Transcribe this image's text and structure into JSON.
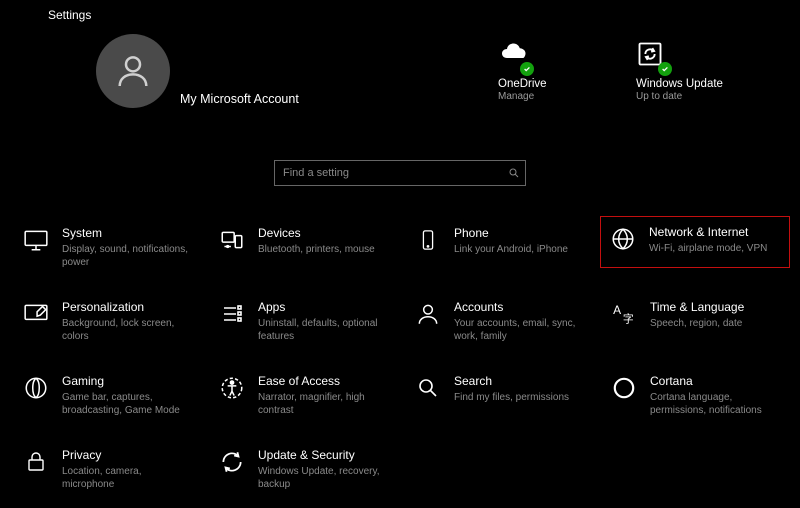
{
  "window_title": "Settings",
  "account": {
    "name": "My Microsoft Account"
  },
  "status_tiles": {
    "onedrive": {
      "title": "OneDrive",
      "subtitle": "Manage"
    },
    "update": {
      "title": "Windows Update",
      "subtitle": "Up to date"
    }
  },
  "search": {
    "placeholder": "Find a setting"
  },
  "categories": {
    "system": {
      "title": "System",
      "subtitle": "Display, sound, notifications, power"
    },
    "devices": {
      "title": "Devices",
      "subtitle": "Bluetooth, printers, mouse"
    },
    "phone": {
      "title": "Phone",
      "subtitle": "Link your Android, iPhone"
    },
    "network": {
      "title": "Network & Internet",
      "subtitle": "Wi-Fi, airplane mode, VPN"
    },
    "personalization": {
      "title": "Personalization",
      "subtitle": "Background, lock screen, colors"
    },
    "apps": {
      "title": "Apps",
      "subtitle": "Uninstall, defaults, optional features"
    },
    "accounts": {
      "title": "Accounts",
      "subtitle": "Your accounts, email, sync, work, family"
    },
    "time": {
      "title": "Time & Language",
      "subtitle": "Speech, region, date"
    },
    "gaming": {
      "title": "Gaming",
      "subtitle": "Game bar, captures, broadcasting, Game Mode"
    },
    "ease": {
      "title": "Ease of Access",
      "subtitle": "Narrator, magnifier, high contrast"
    },
    "search_cat": {
      "title": "Search",
      "subtitle": "Find my files, permissions"
    },
    "cortana": {
      "title": "Cortana",
      "subtitle": "Cortana language, permissions, notifications"
    },
    "privacy": {
      "title": "Privacy",
      "subtitle": "Location, camera, microphone"
    },
    "update": {
      "title": "Update & Security",
      "subtitle": "Windows Update, recovery, backup"
    }
  },
  "highlighted_category": "network"
}
